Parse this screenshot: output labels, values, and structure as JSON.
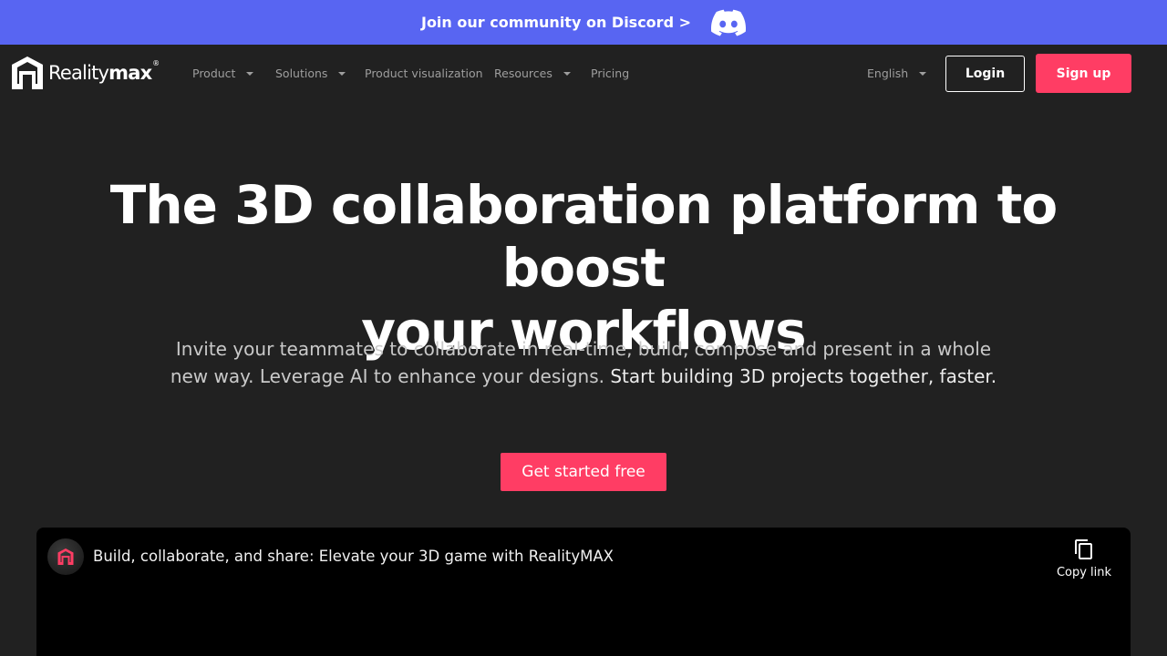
{
  "banner": {
    "text": "Join our community on Discord >",
    "icon": "discord-icon",
    "bg_color": "#5865f2"
  },
  "logo": {
    "text_main": "Reality",
    "text_bold": "max",
    "registered": "®"
  },
  "nav": {
    "items": [
      {
        "label": "Product",
        "has_dropdown": true
      },
      {
        "label": "Solutions",
        "has_dropdown": true
      },
      {
        "label": "Product visualization",
        "has_dropdown": false
      },
      {
        "label": "Resources",
        "has_dropdown": true
      },
      {
        "label": "Pricing",
        "has_dropdown": false
      }
    ],
    "language": "English",
    "login_label": "Login",
    "signup_label": "Sign up",
    "accent_color": "#ff3d64"
  },
  "hero": {
    "title_line1": "The 3D collaboration platform to boost",
    "title_line2": "your workflows",
    "subtitle": "Invite your teammates to collaborate in real-time, build, compose and present in a whole new way. Leverage AI to enhance your designs.",
    "subtitle_strong": "Start building 3D projects together, faster.",
    "cta_label": "Get started free"
  },
  "video": {
    "title": "Build, collaborate, and share: Elevate your 3D game with RealityMAX",
    "copy_label": "Copy link",
    "copy_icon": "copy-icon",
    "avatar_icon": "realitymax-logo-icon"
  }
}
